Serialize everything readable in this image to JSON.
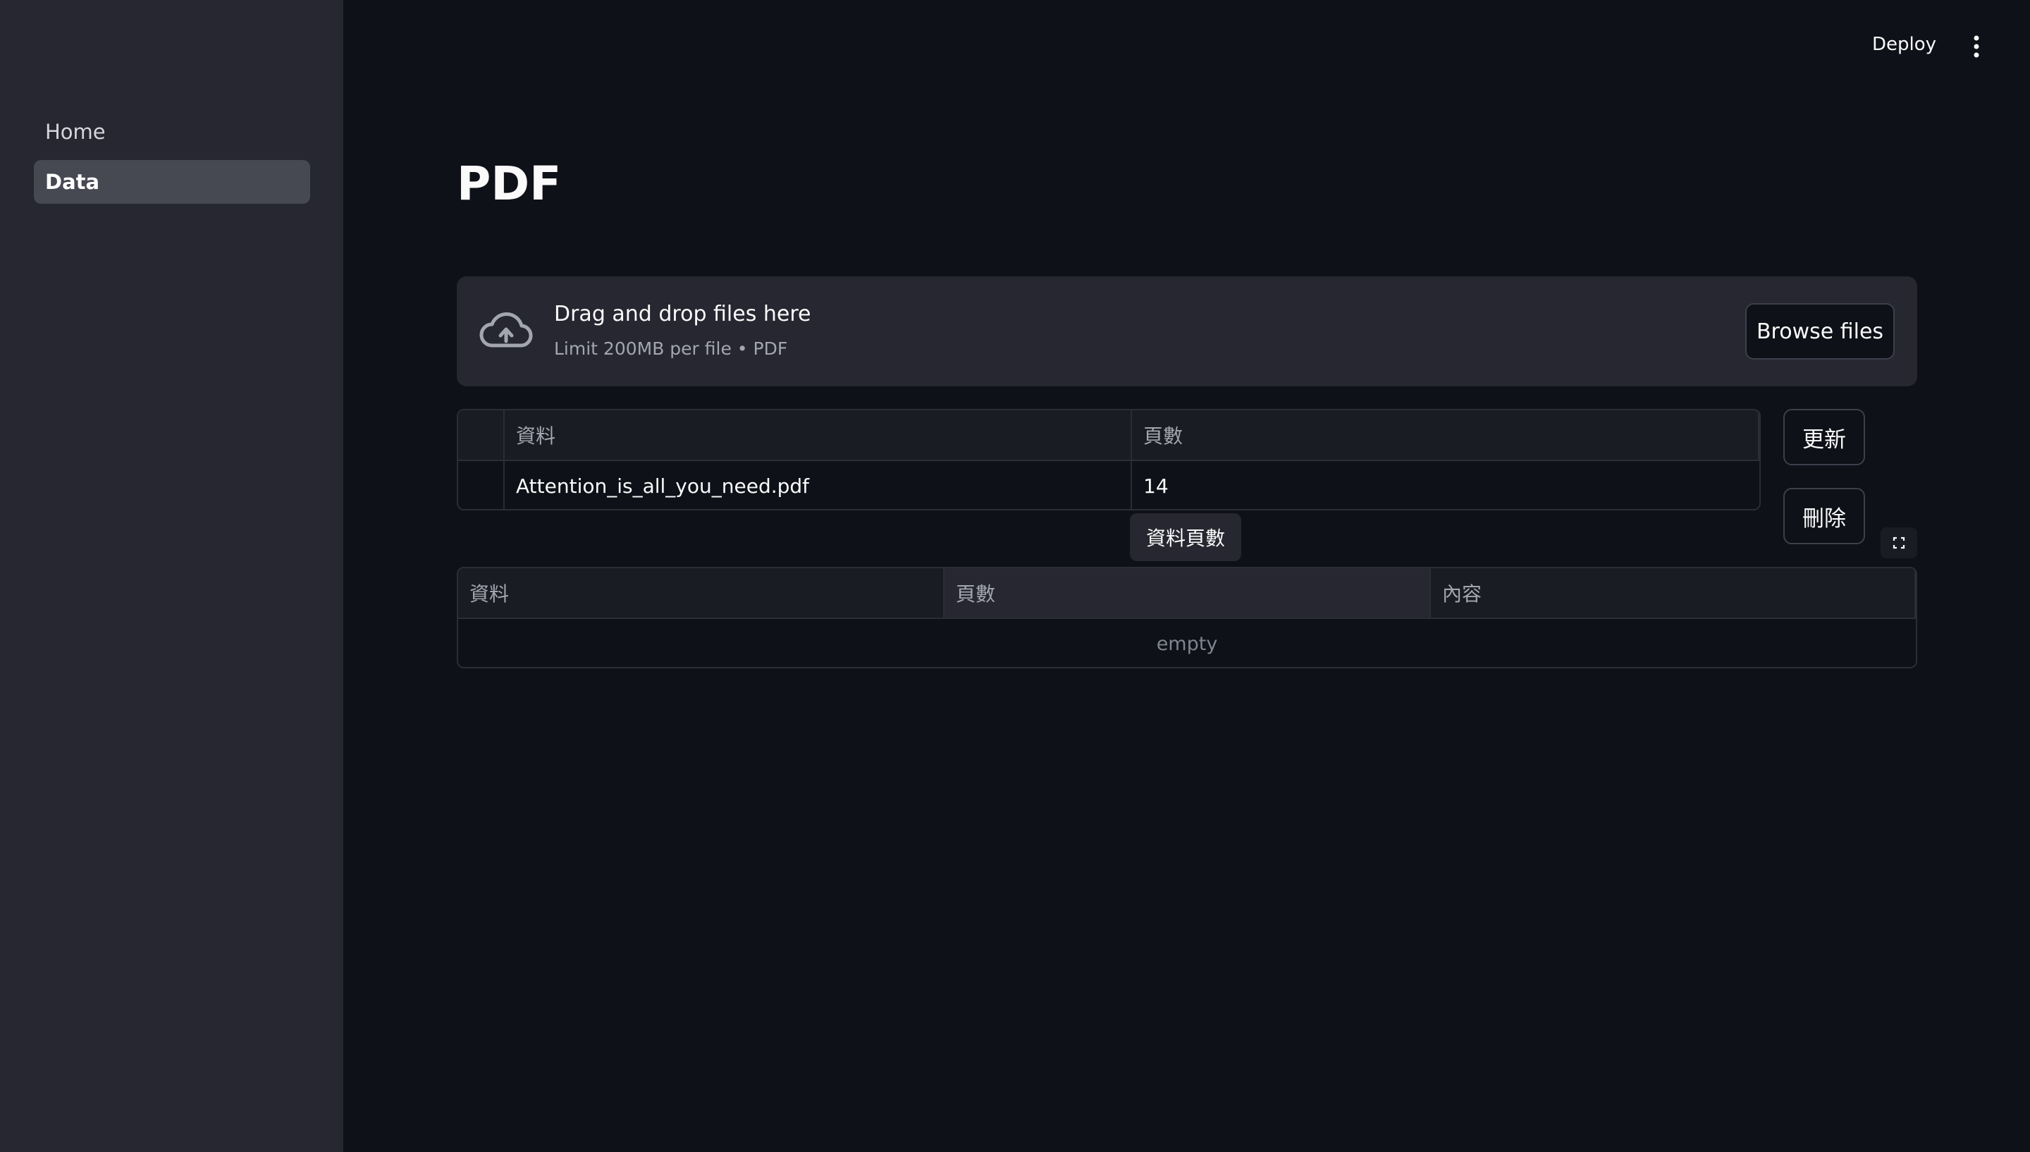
{
  "sidebar": {
    "items": [
      {
        "label": "Home",
        "active": false
      },
      {
        "label": "Data",
        "active": true
      }
    ]
  },
  "header": {
    "deploy_label": "Deploy",
    "menu_icon": "vertical-dots-icon"
  },
  "main": {
    "title": "PDF",
    "uploader": {
      "icon": "cloud-upload-icon",
      "title": "Drag and drop files here",
      "subtitle": "Limit 200MB per file • PDF",
      "browse_label": "Browse files"
    },
    "files_table": {
      "columns": [
        "資料",
        "頁數"
      ],
      "rows": [
        [
          "Attention_is_all_you_need.pdf",
          "14"
        ]
      ]
    },
    "update_label": "更新",
    "delete_label": "刪除",
    "tooltip": "資料頁數",
    "fullscreen_icon": "fullscreen-icon",
    "content_table": {
      "columns": [
        "資料",
        "頁數",
        "內容"
      ],
      "empty_text": "empty"
    }
  },
  "colors": {
    "background": "#0e1117",
    "sidebar": "#262730",
    "active_nav": "#464852",
    "border": "#2b2d37"
  }
}
